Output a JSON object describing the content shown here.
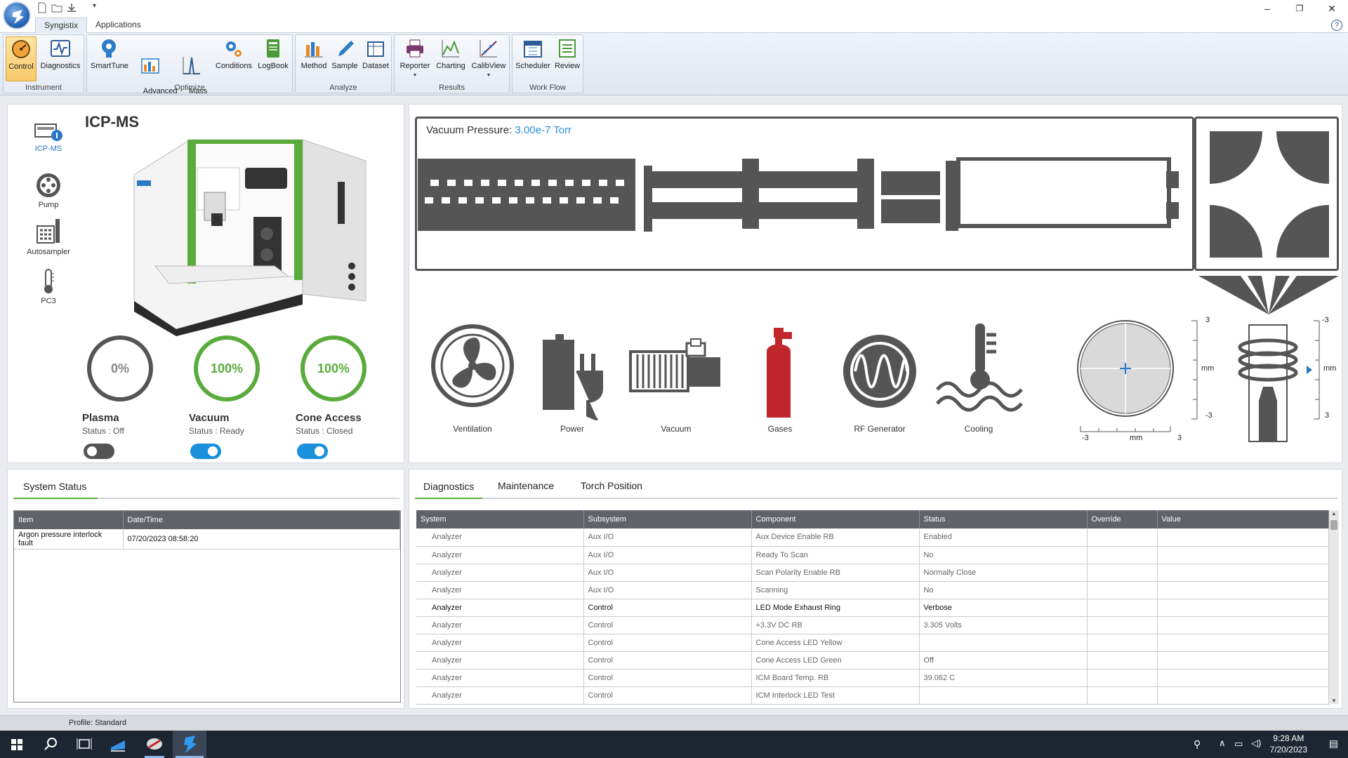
{
  "ribbon": {
    "tabs": [
      "Syngistix",
      "Applications"
    ],
    "groups": [
      {
        "label": "Instrument",
        "buttons": [
          "Control",
          "Diagnostics"
        ]
      },
      {
        "label": "Optimize",
        "buttons": [
          "SmartTune",
          "Advanced\nOptimize",
          "Mass\nCalibration",
          "Conditions",
          "LogBook"
        ]
      },
      {
        "label": "Analyze",
        "buttons": [
          "Method",
          "Sample",
          "Dataset"
        ]
      },
      {
        "label": "Results",
        "buttons": [
          "Reporter",
          "Charting",
          "CalibView"
        ]
      },
      {
        "label": "Work Flow",
        "buttons": [
          "Scheduler",
          "Review"
        ]
      }
    ]
  },
  "left_nav": [
    "ICP-MS",
    "Pump",
    "Autosampler",
    "PC3"
  ],
  "instrument": {
    "title": "ICP-MS",
    "gauges": [
      {
        "label": "Plasma",
        "value": "0%",
        "percent": 0,
        "status": "Status :  Off",
        "toggle_on": false
      },
      {
        "label": "Vacuum",
        "value": "100%",
        "percent": 100,
        "status": "Status :  Ready",
        "toggle_on": true
      },
      {
        "label": "Cone Access",
        "value": "100%",
        "percent": 100,
        "status": "Status :  Closed",
        "toggle_on": true
      }
    ]
  },
  "vacuum": {
    "label": "Vacuum Pressure:",
    "value": "3.00e-7 Torr"
  },
  "systems": [
    "Ventilation",
    "Power",
    "Vacuum",
    "Gases",
    "RF Generator",
    "Cooling"
  ],
  "torch": {
    "axis_x": [
      "-3",
      "mm",
      "3"
    ],
    "axis_y": [
      "3",
      "mm",
      "-3"
    ],
    "axis_z": [
      "-3",
      "mm",
      "3"
    ]
  },
  "system_status": {
    "tab": "System Status",
    "columns": [
      "Item",
      "Date/Time"
    ],
    "rows": [
      [
        "Argon pressure interlock fault",
        "07/20/2023 08:58:20"
      ]
    ]
  },
  "diagnostics": {
    "tabs": [
      "Diagnostics",
      "Maintenance",
      "Torch Position"
    ],
    "columns": [
      "System",
      "Subsystem",
      "Component",
      "Status",
      "Override",
      "Value"
    ],
    "rows": [
      [
        "Analyzer",
        "Aux I/O",
        "Aux Device Enable RB",
        "Enabled",
        "",
        ""
      ],
      [
        "Analyzer",
        "Aux I/O",
        "Ready To Scan",
        "No",
        "",
        ""
      ],
      [
        "Analyzer",
        "Aux I/O",
        "Scan Polarity Enable RB",
        "Normally Close",
        "",
        ""
      ],
      [
        "Analyzer",
        "Aux I/O",
        "Scanning",
        "No",
        "",
        ""
      ],
      [
        "Analyzer",
        "Control",
        "LED Mode Exhaust Ring",
        "Verbose",
        "",
        ""
      ],
      [
        "Analyzer",
        "Control",
        "+3.3V DC RB",
        "3.305 Volts",
        "",
        ""
      ],
      [
        "Analyzer",
        "Control",
        "Cone Access LED Yellow",
        "",
        "",
        ""
      ],
      [
        "Analyzer",
        "Control",
        "Cone Access LED Green",
        "Off",
        "",
        ""
      ],
      [
        "Analyzer",
        "Control",
        "ICM Board Temp. RB",
        "39.062 C",
        "",
        ""
      ],
      [
        "Analyzer",
        "Control",
        "ICM Interlock LED Test",
        "",
        "",
        ""
      ]
    ],
    "selected_row": 4
  },
  "statusbar": {
    "profile": "Profile: Standard"
  },
  "taskbar": {
    "time": "9:28 AM",
    "date": "7/20/2023"
  },
  "colors": {
    "accent_green": "#5aab3c",
    "toggle_blue": "#1a8fdc",
    "gas_red": "#c0272d",
    "link_blue": "#2a8fd6"
  }
}
